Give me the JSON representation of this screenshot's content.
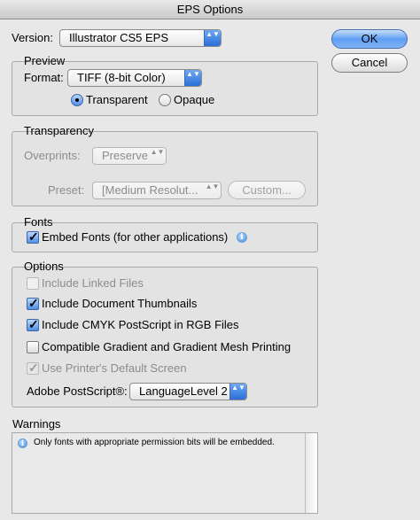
{
  "window": {
    "title": "EPS Options"
  },
  "version": {
    "label": "Version:",
    "value": "Illustrator CS5 EPS"
  },
  "buttons": {
    "ok": "OK",
    "cancel": "Cancel"
  },
  "preview": {
    "title": "Preview",
    "format_label": "Format:",
    "format_value": "TIFF (8-bit Color)",
    "transparent_label": "Transparent",
    "opaque_label": "Opaque",
    "selected": "transparent"
  },
  "transparency": {
    "title": "Transparency",
    "overprints_label": "Overprints:",
    "overprints_value": "Preserve",
    "preset_label": "Preset:",
    "preset_value": "[Medium Resolut...",
    "custom_button": "Custom..."
  },
  "fonts": {
    "title": "Fonts",
    "embed_label": "Embed Fonts (for other applications)",
    "embed_checked": true
  },
  "options": {
    "title": "Options",
    "items": [
      {
        "label": "Include Linked Files",
        "checked": false,
        "enabled": false
      },
      {
        "label": "Include Document Thumbnails",
        "checked": true,
        "enabled": true
      },
      {
        "label": "Include CMYK PostScript in RGB Files",
        "checked": true,
        "enabled": true
      },
      {
        "label": "Compatible Gradient and Gradient Mesh Printing",
        "checked": false,
        "enabled": true
      },
      {
        "label": "Use Printer's Default Screen",
        "checked": true,
        "enabled": false
      }
    ],
    "postscript_label": "Adobe PostScript®:",
    "postscript_value": "LanguageLevel 2"
  },
  "warnings": {
    "title": "Warnings",
    "message": "Only fonts with appropriate permission bits will be embedded."
  },
  "icons": {
    "popup_arrows": "▲▼",
    "check": "✓",
    "info": "i"
  }
}
